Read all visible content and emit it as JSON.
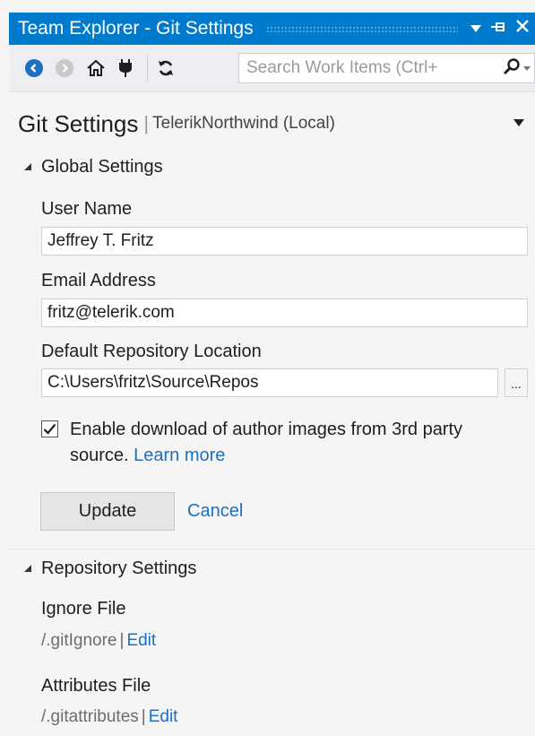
{
  "window": {
    "title": "Team Explorer - Git Settings",
    "title_icons": [
      "dropdown-arrow-icon",
      "pin-icon",
      "close-icon"
    ]
  },
  "toolbar": {
    "icons": [
      "back-icon",
      "forward-icon",
      "home-icon",
      "connect-icon",
      "refresh-icon"
    ],
    "search_placeholder": "Search Work Items (Ctrl+"
  },
  "header": {
    "title": "Git Settings",
    "separator": "|",
    "subtitle": "TelerikNorthwind (Local)"
  },
  "global_settings": {
    "heading": "Global Settings",
    "user_name_label": "User Name",
    "user_name_value": "Jeffrey T. Fritz",
    "email_label": "Email Address",
    "email_value": "fritz@telerik.com",
    "repo_location_label": "Default Repository Location",
    "repo_location_value": "C:\\Users\\fritz\\Source\\Repos",
    "browse_label": "...",
    "checkbox_checked": true,
    "checkbox_text": "Enable download of author images from 3rd party source.",
    "learn_more": "Learn more",
    "update_button": "Update",
    "cancel_link": "Cancel"
  },
  "repository_settings": {
    "heading": "Repository Settings",
    "ignore_label": "Ignore File",
    "ignore_file": "/.gitIgnore",
    "ignore_edit": "Edit",
    "attributes_label": "Attributes File",
    "attributes_file": "/.gitattributes",
    "attributes_edit": "Edit",
    "pipe": "|"
  },
  "colors": {
    "titlebar": "#007acc",
    "link": "#1e6fbf",
    "background": "#f5f5f5"
  }
}
